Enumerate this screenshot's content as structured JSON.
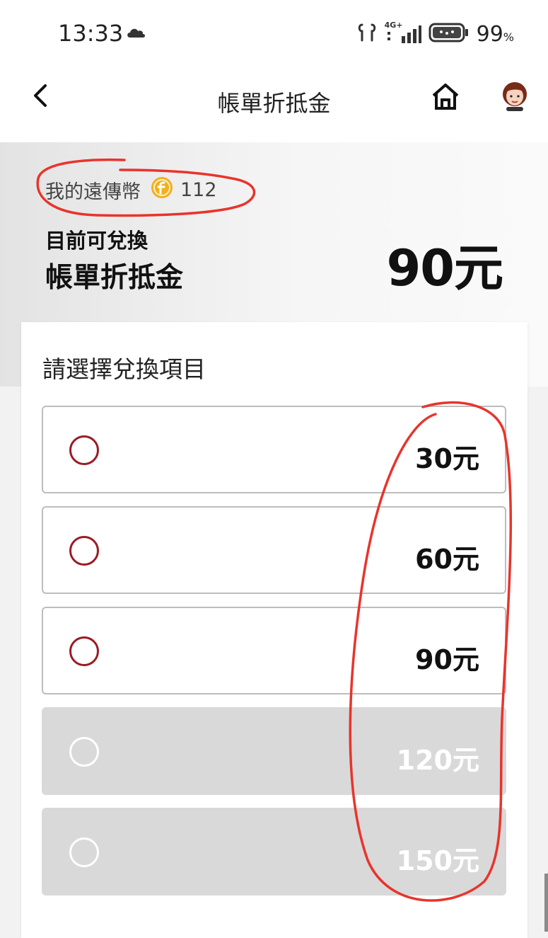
{
  "status_bar": {
    "time": "13:33",
    "network": "4G+",
    "battery": "99",
    "battery_unit": "%"
  },
  "header": {
    "title": "帳單折抵金",
    "icons": [
      "back-arrow-icon",
      "home-icon",
      "avatar"
    ]
  },
  "hero": {
    "coins_label": "我的遠傳幣",
    "coins_value": "112",
    "subtitle": "目前可兌換",
    "title": "帳單折抵金",
    "amount": "90元"
  },
  "card": {
    "title": "請選擇兌換項目",
    "options": [
      {
        "label": "30元",
        "enabled": true
      },
      {
        "label": "60元",
        "enabled": true
      },
      {
        "label": "90元",
        "enabled": true
      },
      {
        "label": "120元",
        "enabled": false
      },
      {
        "label": "150元",
        "enabled": false
      }
    ]
  },
  "colors": {
    "radio_accent": "#9b1c25",
    "disabled_option": "#d9d9d9",
    "annotation": "#e8342c",
    "coin": "#f2b01e"
  }
}
